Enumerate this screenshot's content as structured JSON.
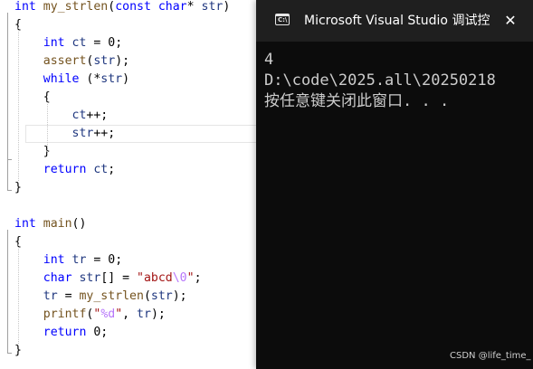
{
  "editor": {
    "code_lines": [
      {
        "parts": [
          {
            "t": "int",
            "c": "kw"
          },
          {
            "t": " "
          },
          {
            "t": "my_strlen",
            "c": "fn"
          },
          {
            "t": "("
          },
          {
            "t": "const",
            "c": "kw"
          },
          {
            "t": " "
          },
          {
            "t": "char",
            "c": "kw"
          },
          {
            "t": "* "
          },
          {
            "t": "str",
            "c": "var"
          },
          {
            "t": ")"
          }
        ]
      },
      {
        "parts": [
          {
            "t": "{"
          }
        ]
      },
      {
        "parts": [
          {
            "t": "    "
          },
          {
            "t": "int",
            "c": "kw"
          },
          {
            "t": " "
          },
          {
            "t": "ct",
            "c": "var"
          },
          {
            "t": " = 0;"
          }
        ]
      },
      {
        "parts": [
          {
            "t": "    "
          },
          {
            "t": "assert",
            "c": "fn"
          },
          {
            "t": "("
          },
          {
            "t": "str",
            "c": "var"
          },
          {
            "t": ");"
          }
        ]
      },
      {
        "parts": [
          {
            "t": "    "
          },
          {
            "t": "while",
            "c": "kw"
          },
          {
            "t": " (*"
          },
          {
            "t": "str",
            "c": "var"
          },
          {
            "t": ")"
          }
        ]
      },
      {
        "parts": [
          {
            "t": "    {"
          }
        ]
      },
      {
        "parts": [
          {
            "t": "        "
          },
          {
            "t": "ct",
            "c": "var"
          },
          {
            "t": "++;"
          }
        ]
      },
      {
        "parts": [
          {
            "t": "        "
          },
          {
            "t": "str",
            "c": "var"
          },
          {
            "t": "++;"
          }
        ]
      },
      {
        "parts": [
          {
            "t": "    }"
          }
        ]
      },
      {
        "parts": [
          {
            "t": "    "
          },
          {
            "t": "return",
            "c": "kw"
          },
          {
            "t": " "
          },
          {
            "t": "ct",
            "c": "var"
          },
          {
            "t": ";"
          }
        ]
      },
      {
        "parts": [
          {
            "t": "}"
          }
        ]
      },
      {
        "parts": []
      },
      {
        "parts": [
          {
            "t": "int",
            "c": "kw"
          },
          {
            "t": " "
          },
          {
            "t": "main",
            "c": "fn"
          },
          {
            "t": "()"
          }
        ]
      },
      {
        "parts": [
          {
            "t": "{"
          }
        ]
      },
      {
        "parts": [
          {
            "t": "    "
          },
          {
            "t": "int",
            "c": "kw"
          },
          {
            "t": " "
          },
          {
            "t": "tr",
            "c": "var"
          },
          {
            "t": " = 0;"
          }
        ]
      },
      {
        "parts": [
          {
            "t": "    "
          },
          {
            "t": "char",
            "c": "kw"
          },
          {
            "t": " "
          },
          {
            "t": "str",
            "c": "var"
          },
          {
            "t": "[] = "
          },
          {
            "t": "\"abcd",
            "c": "str"
          },
          {
            "t": "\\0",
            "c": "esc"
          },
          {
            "t": "\"",
            "c": "str"
          },
          {
            "t": ";"
          }
        ]
      },
      {
        "parts": [
          {
            "t": "    "
          },
          {
            "t": "tr",
            "c": "var"
          },
          {
            "t": " = "
          },
          {
            "t": "my_strlen",
            "c": "fn"
          },
          {
            "t": "("
          },
          {
            "t": "str",
            "c": "var"
          },
          {
            "t": ");"
          }
        ]
      },
      {
        "parts": [
          {
            "t": "    "
          },
          {
            "t": "printf",
            "c": "fn"
          },
          {
            "t": "("
          },
          {
            "t": "\"",
            "c": "str"
          },
          {
            "t": "%d",
            "c": "esc"
          },
          {
            "t": "\"",
            "c": "str"
          },
          {
            "t": ", "
          },
          {
            "t": "tr",
            "c": "var"
          },
          {
            "t": ");"
          }
        ]
      },
      {
        "parts": [
          {
            "t": "    "
          },
          {
            "t": "return",
            "c": "kw"
          },
          {
            "t": " 0;"
          }
        ]
      },
      {
        "parts": [
          {
            "t": "}"
          }
        ]
      }
    ],
    "highlighted_line": 7,
    "colors": {
      "keyword": "#0000ff",
      "function": "#74531f",
      "variable": "#1f377f",
      "string": "#a31515",
      "escape": "#b776fb"
    }
  },
  "console": {
    "title": "Microsoft Visual Studio 调试控",
    "icon": "console-window-icon",
    "icon_glyph": "C:\\",
    "close_glyph": "✕",
    "output_lines": [
      "4",
      "D:\\code\\2025.all\\20250218",
      "按任意键关闭此窗口. . ."
    ],
    "background": "#0c0c0c",
    "text_color": "#cccccc"
  },
  "watermark": "CSDN @life_time_"
}
